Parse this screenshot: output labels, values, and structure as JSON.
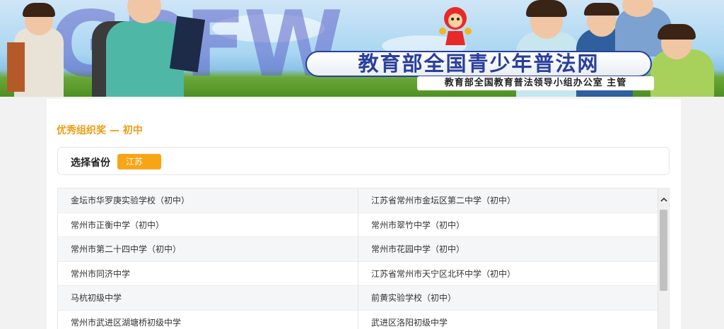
{
  "banner": {
    "watermark": "GPFW",
    "site_title": "教育部全国青少年普法网",
    "host": "教育部全国教育普法领导小组办公室 主管"
  },
  "section": {
    "title": "优秀组织奖 — 初中"
  },
  "province": {
    "label": "选择省份",
    "selected": "江苏"
  },
  "schools": [
    [
      "金坛市华罗庚实验学校（初中）",
      "江苏省常州市金坛区第二中学（初中）"
    ],
    [
      "常州市正衡中学（初中）",
      "常州市翠竹中学（初中）"
    ],
    [
      "常州市第二十四中学（初中）",
      "常州市花园中学（初中）"
    ],
    [
      "常州市同济中学",
      "江苏省常州市天宁区北环中学（初中）"
    ],
    [
      "马杭初级中学",
      "前黄实验学校（初中）"
    ],
    [
      "常州市武进区湖塘桥初级中学",
      "武进区洛阳初级中学"
    ]
  ],
  "icons": {
    "scroll_up": "chevron-up-icon"
  },
  "colors": {
    "accent": "#f29b11",
    "button": "#f8a515",
    "title_blue": "#2a3f9d"
  }
}
